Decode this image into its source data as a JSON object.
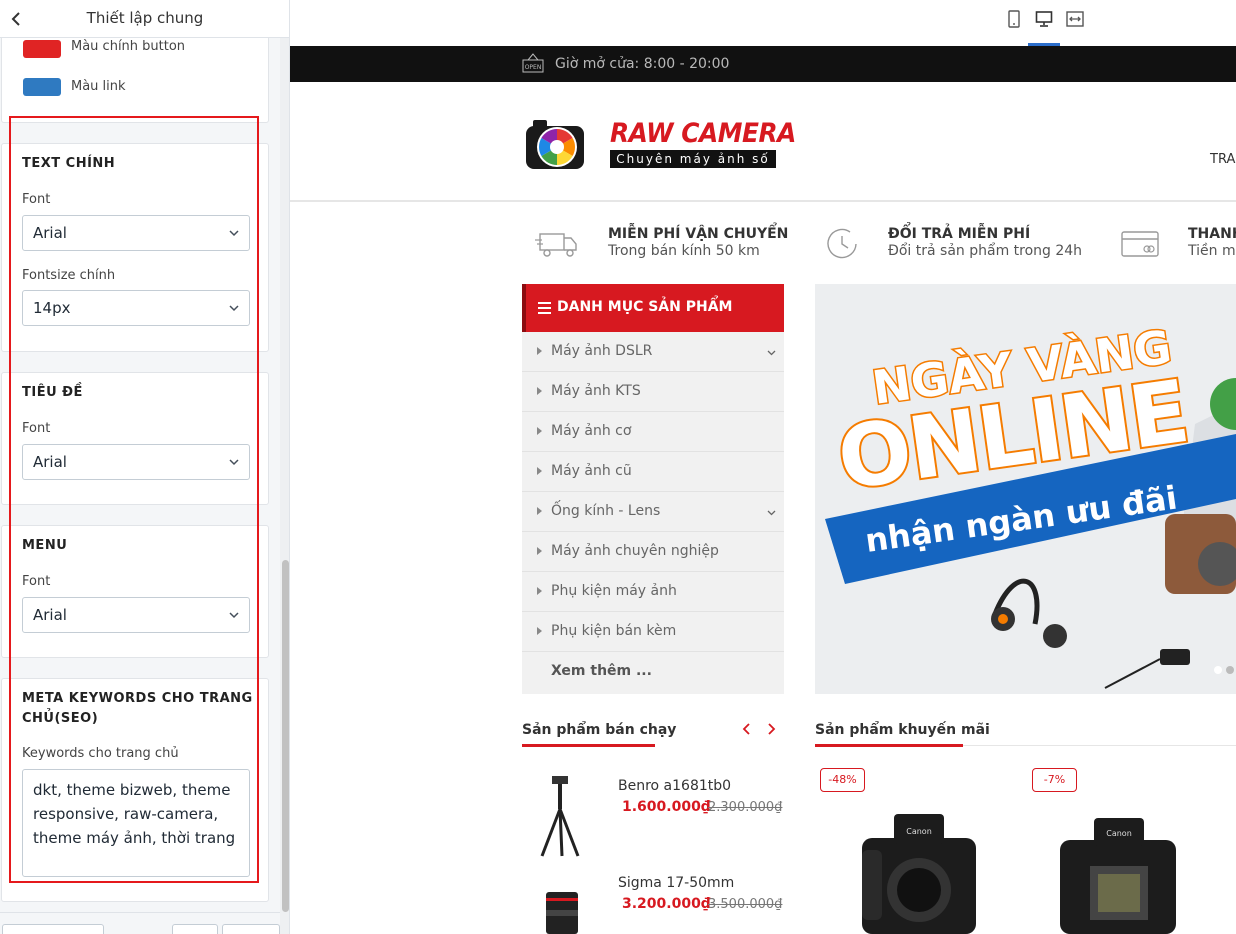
{
  "panel": {
    "title": "Thiết lập chung",
    "colors": [
      {
        "label": "Màu chính button",
        "color": "#e02424"
      },
      {
        "label": "Màu link",
        "color": "#2f7ac1"
      }
    ],
    "sections": {
      "text_main": {
        "title": "TEXT CHÍNH",
        "font_label": "Font",
        "font_value": "Arial",
        "size_label": "Fontsize chính",
        "size_value": "14px"
      },
      "heading": {
        "title": "TIÊU ĐỀ",
        "font_label": "Font",
        "font_value": "Arial"
      },
      "menu": {
        "title": "MENU",
        "font_label": "Font",
        "font_value": "Arial"
      },
      "seo": {
        "title_line1": "META KEYWORDS CHO TRANG",
        "title_line2": "CHỦ(SEO)",
        "keywords_label": "Keywords cho trang chủ",
        "keywords_value": "dkt, theme bizweb, theme responsive, raw-camera, theme máy ảnh, thời trang"
      }
    }
  },
  "toolbar": {
    "devices": [
      "mobile-icon",
      "desktop-icon",
      "fullwidth-icon"
    ],
    "active_device": "desktop"
  },
  "site": {
    "topbar": {
      "open_icon_text": "OPEN",
      "hours": "Giờ mở cửa: 8:00 - 20:00"
    },
    "logo": {
      "name": "RAW CAMERA",
      "tagline": "Chuyên máy ảnh số"
    },
    "nav_partial": "TRA",
    "services": [
      {
        "title": "MIỄN PHÍ VẬN CHUYỂN",
        "sub": "Trong bán kính 50 km"
      },
      {
        "title": "ĐỔI TRẢ MIỄN PHÍ",
        "sub": "Đổi trả sản phẩm trong 24h"
      },
      {
        "title": "THANH",
        "sub": "Tiền mặ"
      }
    ],
    "categories": {
      "title": "DANH MỤC SẢN PHẨM",
      "items": [
        {
          "label": "Máy ảnh DSLR",
          "has_sub": true
        },
        {
          "label": "Máy ảnh KTS",
          "has_sub": false
        },
        {
          "label": "Máy ảnh cơ",
          "has_sub": false
        },
        {
          "label": "Máy ảnh cũ",
          "has_sub": false
        },
        {
          "label": "Ống kính - Lens",
          "has_sub": true
        },
        {
          "label": "Máy ảnh chuyên nghiệp",
          "has_sub": false
        },
        {
          "label": "Phụ kiện máy ảnh",
          "has_sub": false
        },
        {
          "label": "Phụ kiện bán kèm",
          "has_sub": false
        }
      ],
      "more": "Xem thêm ..."
    },
    "banner": {
      "line1": "NGÀY VÀNG",
      "line2": "ONLINE",
      "line3": "nhận ngàn ưu đãi"
    },
    "bestsellers": {
      "title": "Sản phẩm bán chạy",
      "items": [
        {
          "name": "Benro a1681tb0",
          "price": "1.600.000₫",
          "old_price": "2.300.000₫"
        },
        {
          "name": "Sigma 17-50mm",
          "price": "3.200.000₫",
          "old_price": "3.500.000₫"
        }
      ]
    },
    "promos": {
      "title": "Sản phẩm khuyến mãi",
      "badges": [
        "-48%",
        "-7%"
      ],
      "brand": "Canon"
    }
  }
}
